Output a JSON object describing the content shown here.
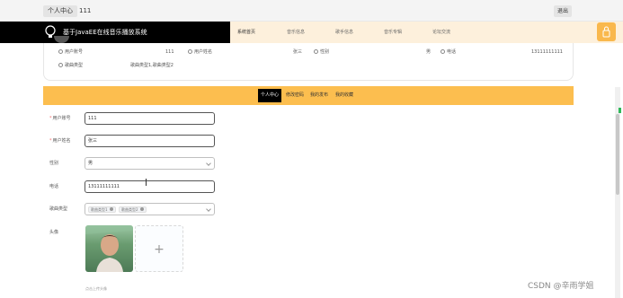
{
  "topbar": {
    "center_label": "个人中心",
    "username": "111",
    "logout_label": "退出"
  },
  "nav": {
    "site_title": "基于JavaEE在线音乐播放系统",
    "links": [
      "系统首页",
      "音乐信息",
      "歌手信息",
      "音乐专辑",
      "论坛交流"
    ],
    "active_index": 0,
    "accent_color": "#fcbe4f"
  },
  "profile_card": {
    "account_label": "用户账号",
    "account_value": "111",
    "name_label": "用户姓名",
    "name_value": "张三",
    "gender_label": "性别",
    "gender_value": "男",
    "phone_label": "电话",
    "phone_value": "13111111111",
    "genre_label": "歌曲类型",
    "genre_value": "歌曲类型1,歌曲类型2"
  },
  "tabs": [
    "个人中心",
    "修改密码",
    "我的发布",
    "我的收藏"
  ],
  "form": {
    "account_label": "用户账号",
    "account_value": "111",
    "name_label": "用户姓名",
    "name_value": "张三",
    "gender_label": "性别",
    "gender_value": "男",
    "phone_label": "电话",
    "phone_value": "13111111111",
    "genre_label": "歌曲类型",
    "genre_chips": [
      "歌曲类型1",
      "歌曲类型2"
    ],
    "avatar_label": "头像",
    "upload_hint": "点击上传头像"
  },
  "watermark": "CSDN @辛雨学姐"
}
